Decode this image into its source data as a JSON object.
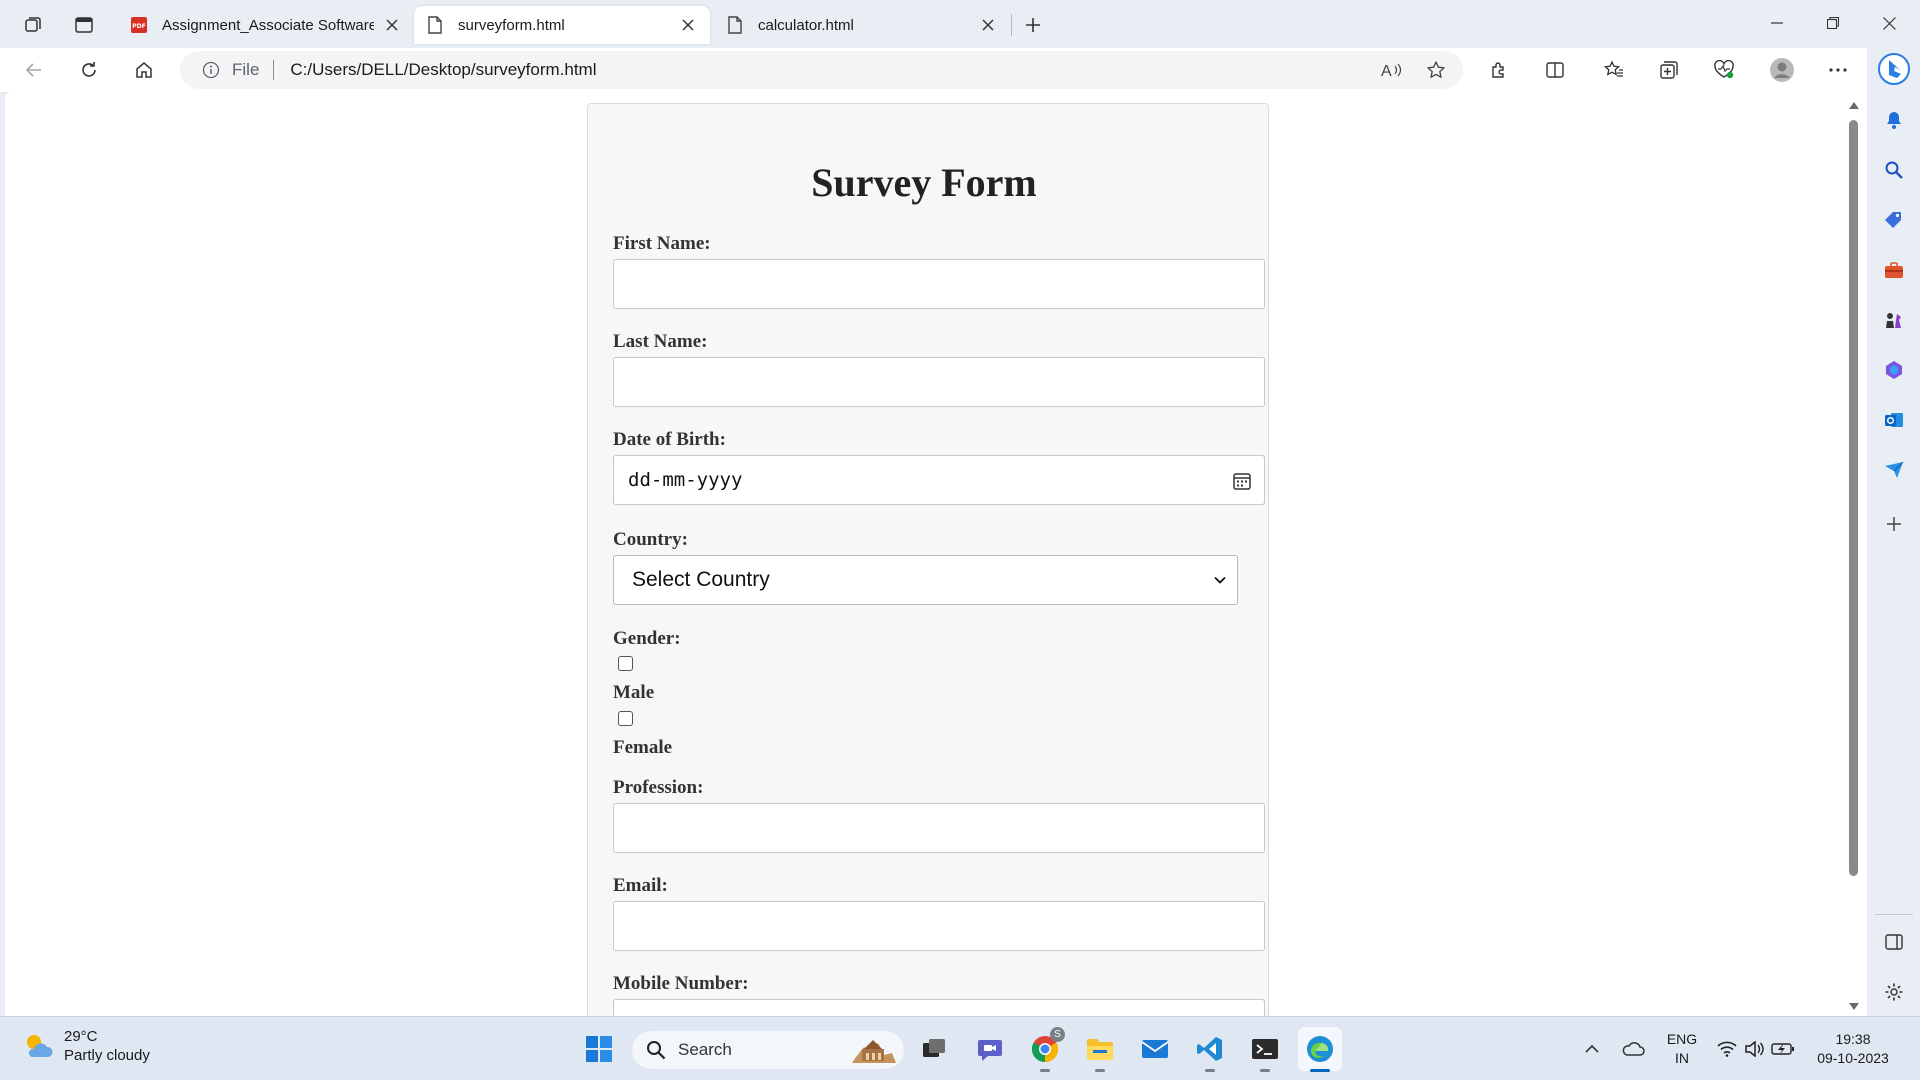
{
  "browser": {
    "tabs": [
      {
        "title": "Assignment_Associate Software E",
        "icon": "pdf-icon",
        "active": false
      },
      {
        "title": "surveyform.html",
        "icon": "file-icon",
        "active": true
      },
      {
        "title": "calculator.html",
        "icon": "file-icon",
        "active": false
      }
    ],
    "address": {
      "scheme_label": "File",
      "url": "C:/Users/DELL/Desktop/surveyform.html"
    }
  },
  "form": {
    "title": "Survey Form",
    "first_name_label": "First Name:",
    "last_name_label": "Last Name:",
    "dob_label": "Date of Birth:",
    "dob_placeholder": "dd-mm-yyyy",
    "country_label": "Country:",
    "country_selected": "Select Country",
    "gender_label": "Gender:",
    "gender_options": [
      "Male",
      "Female"
    ],
    "profession_label": "Profession:",
    "email_label": "Email:",
    "mobile_label": "Mobile Number:"
  },
  "taskbar": {
    "weather": {
      "temp": "29°C",
      "condition": "Partly cloudy"
    },
    "search_label": "Search",
    "lang_line1": "ENG",
    "lang_line2": "IN",
    "time": "19:38",
    "date": "09-10-2023",
    "chrome_badge": "S"
  },
  "colors": {
    "accent": "#0067c0",
    "form_bg": "#f7f7f7",
    "title_text": "#222222"
  }
}
